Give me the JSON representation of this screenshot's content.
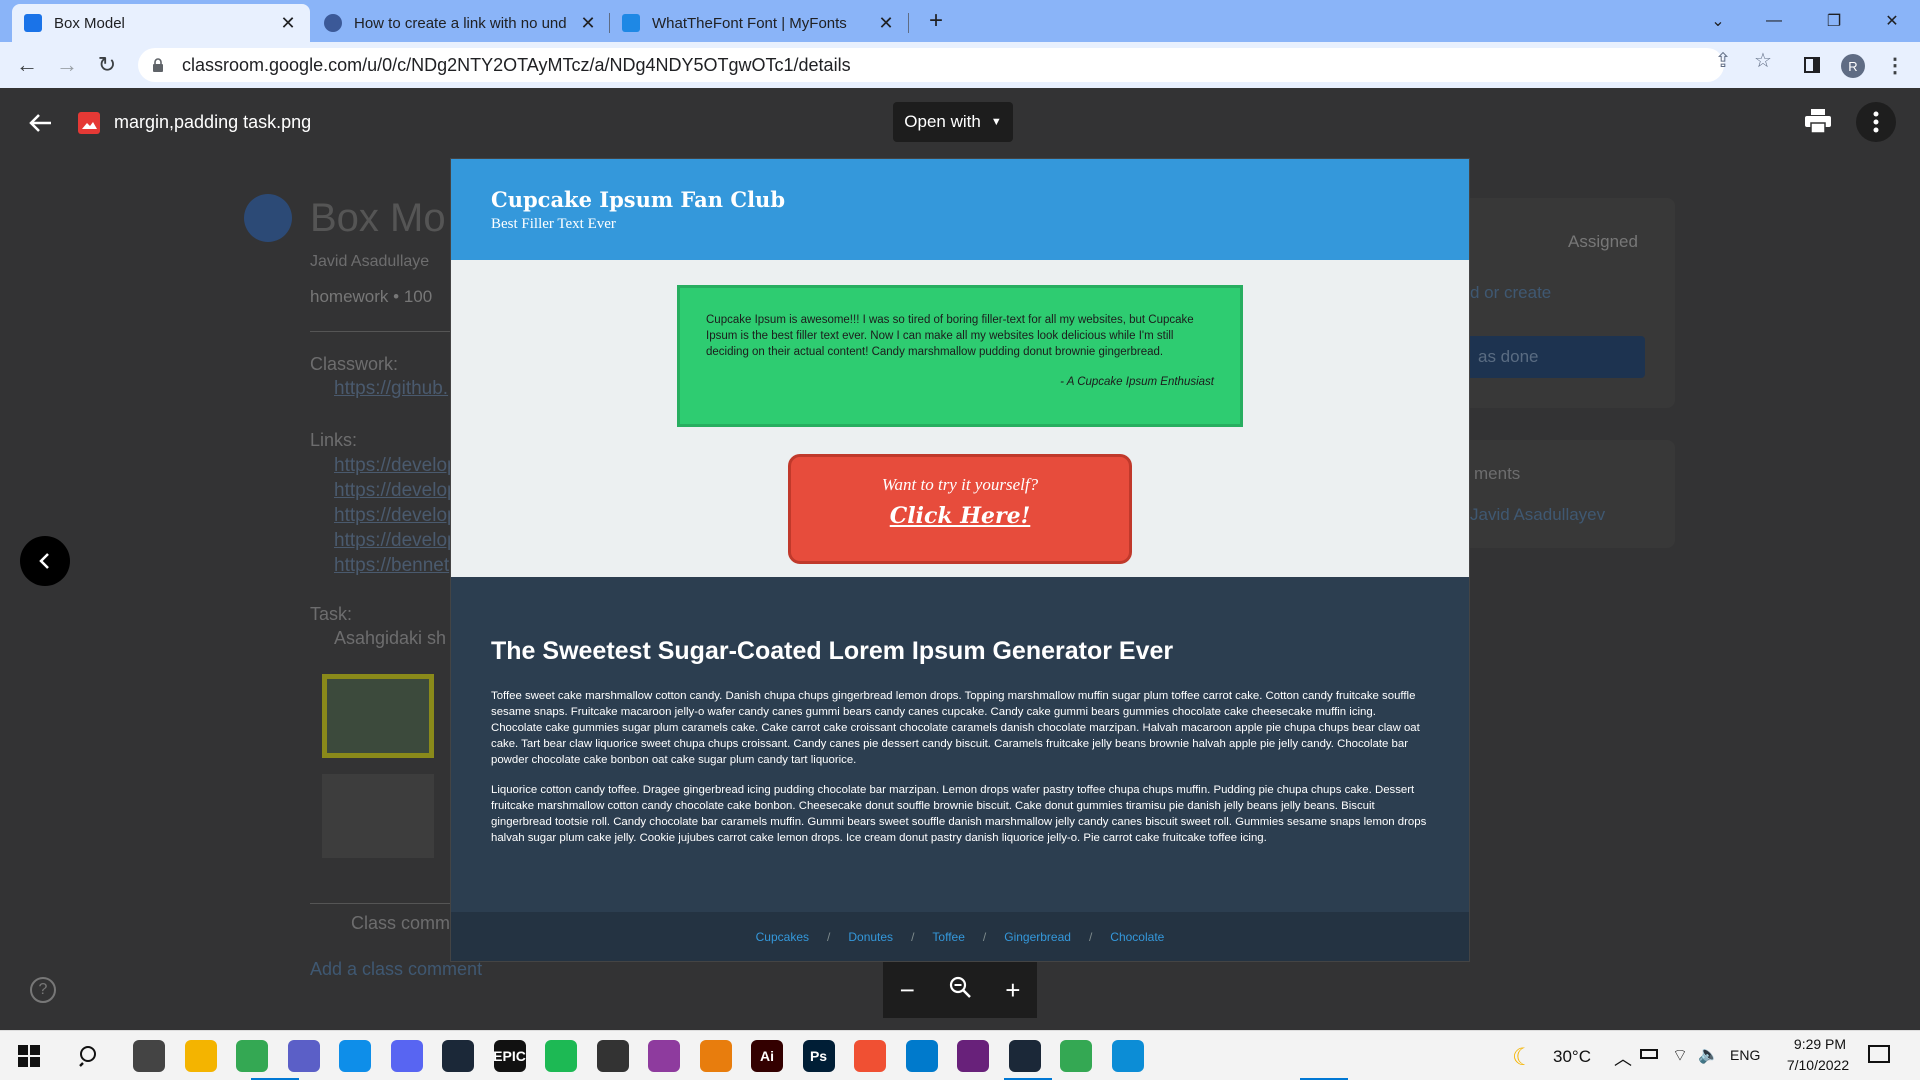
{
  "browser": {
    "tabs": [
      {
        "title": "Box Model",
        "active": true,
        "favicon_color": "#1a73e8"
      },
      {
        "title": "How to create a link with no und",
        "active": false,
        "favicon_color": "#3b5998"
      },
      {
        "title": "WhatTheFont Font | MyFonts",
        "active": false,
        "favicon_color": "#1e88e5"
      }
    ],
    "url": "classroom.google.com/u/0/c/NDg2NTY2OTAyMTcz/a/NDg4NDY5OTgwOTc1/details",
    "profile_initial": "R"
  },
  "viewer": {
    "file_name": "margin,padding task.png",
    "open_with_label": "Open with",
    "zoom": {
      "out": "−",
      "in": "+"
    }
  },
  "background": {
    "title": "Box Mo",
    "author": "Javid Asadullaye",
    "points": "homework • 100",
    "classwork_label": "Classwork:",
    "classwork_link": "https://github.",
    "links_label": "Links:",
    "links": [
      "https://develop",
      "https://develop",
      "https://develop",
      "https://develop",
      "https://bennet"
    ],
    "task_label": "Task:",
    "task_text": "Asahgidaki sh",
    "assigned": "Assigned",
    "add_create": "d or create",
    "mark_done": "as done",
    "comments": "ments",
    "comment_author": "Javid Asadullayev",
    "class_comments": "Class comm",
    "add_comment": "Add a class comment"
  },
  "page": {
    "brand": "Cupcake Ipsum Fan Club",
    "tagline": "Best Filler Text Ever",
    "quote": "Cupcake Ipsum is awesome!!! I was so tired of boring filler-text for all my websites, but Cupcake Ipsum is the best filler text ever. Now I can make all my websites look delicious while I'm still deciding on their actual content! Candy marshmallow pudding donut brownie gingerbread.",
    "quote_by": "- A Cupcake Ipsum Enthusiast",
    "cta_question": "Want to try it yourself?",
    "cta_link": "Click Here!",
    "heading": "The Sweetest Sugar-Coated Lorem Ipsum Generator Ever",
    "para1": "Toffee sweet cake marshmallow cotton candy. Danish chupa chups gingerbread lemon drops. Topping marshmallow muffin sugar plum toffee carrot cake. Cotton candy fruitcake souffle sesame snaps. Fruitcake macaroon jelly-o wafer candy canes gummi bears candy canes cupcake. Candy cake gummi bears gummies chocolate cake cheesecake muffin icing. Chocolate cake gummies sugar plum caramels cake. Cake carrot cake croissant chocolate caramels danish chocolate marzipan. Halvah macaroon apple pie chupa chups bear claw oat cake. Tart bear claw liquorice sweet chupa chups croissant. Candy canes pie dessert candy biscuit. Caramels fruitcake jelly beans brownie halvah apple pie jelly candy. Chocolate bar powder chocolate cake bonbon oat cake sugar plum candy tart liquorice.",
    "para2": "Liquorice cotton candy toffee. Dragee gingerbread icing pudding chocolate bar marzipan. Lemon drops wafer pastry toffee chupa chups muffin. Pudding pie chupa chups cake. Dessert fruitcake marshmallow cotton candy chocolate cake bonbon. Cheesecake donut souffle brownie biscuit. Cake donut gummies tiramisu pie danish jelly beans jelly beans. Biscuit gingerbread tootsie roll. Candy chocolate bar caramels muffin. Gummi bears sweet souffle danish marshmallow jelly candy canes biscuit sweet roll. Gummies sesame snaps lemon drops halvah sugar plum cake jelly. Cookie jujubes carrot cake lemon drops. Ice cream donut pastry danish liquorice jelly-o. Pie carrot cake fruitcake toffee icing.",
    "footer_links": [
      "Cupcakes",
      "Donutes",
      "Toffee",
      "Gingerbread",
      "Chocolate"
    ],
    "footer_sep": "/"
  },
  "taskbar": {
    "apps": [
      {
        "name": "task-view",
        "color": "#444444",
        "label": ""
      },
      {
        "name": "file-explorer",
        "color": "#f4b400",
        "label": ""
      },
      {
        "name": "chrome",
        "color": "#34a853",
        "label": ""
      },
      {
        "name": "teams",
        "color": "#5b5fc7",
        "label": ""
      },
      {
        "name": "teamviewer",
        "color": "#0e8ee9",
        "label": ""
      },
      {
        "name": "discord",
        "color": "#5865f2",
        "label": ""
      },
      {
        "name": "steam",
        "color": "#1b2838",
        "label": ""
      },
      {
        "name": "epic-games",
        "color": "#111111",
        "label": "EPIC"
      },
      {
        "name": "spotify",
        "color": "#1db954",
        "label": ""
      },
      {
        "name": "unity",
        "color": "#333333",
        "label": ""
      },
      {
        "name": "winrar",
        "color": "#8e3b9e",
        "label": ""
      },
      {
        "name": "blender",
        "color": "#e87d0d",
        "label": ""
      },
      {
        "name": "illustrator",
        "color": "#330000",
        "label": "Ai"
      },
      {
        "name": "photoshop",
        "color": "#001e36",
        "label": "Ps"
      },
      {
        "name": "git",
        "color": "#f05033",
        "label": ""
      },
      {
        "name": "vscode",
        "color": "#007acc",
        "label": ""
      },
      {
        "name": "visual-studio",
        "color": "#68217a",
        "label": ""
      },
      {
        "name": "steam-2",
        "color": "#1b2838",
        "label": ""
      },
      {
        "name": "chrome-2",
        "color": "#34a853",
        "label": ""
      },
      {
        "name": "edge",
        "color": "#0c8dd6",
        "label": ""
      }
    ],
    "temperature": "30°C",
    "language": "ENG",
    "time": "9:29 PM",
    "date": "7/10/2022"
  }
}
